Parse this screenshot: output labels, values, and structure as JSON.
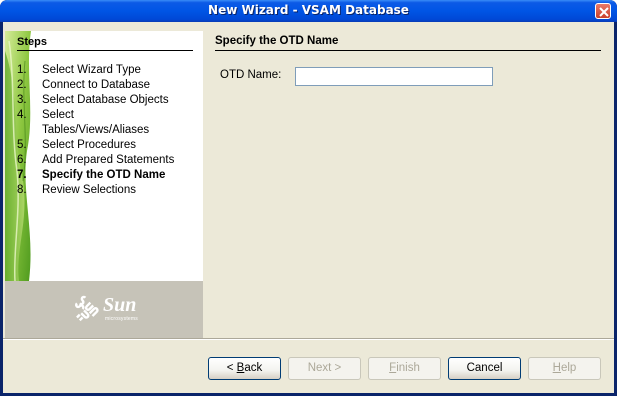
{
  "window": {
    "title": "New Wizard - VSAM Database"
  },
  "steps_panel": {
    "heading": "Steps",
    "items": [
      {
        "num": "1.",
        "label": "Select Wizard Type"
      },
      {
        "num": "2.",
        "label": "Connect to Database"
      },
      {
        "num": "3.",
        "label": "Select Database Objects"
      },
      {
        "num": "4.",
        "label": "Select Tables/Views/Aliases"
      },
      {
        "num": "5.",
        "label": "Select Procedures"
      },
      {
        "num": "6.",
        "label": "Add Prepared Statements"
      },
      {
        "num": "7.",
        "label": "Specify the OTD Name"
      },
      {
        "num": "8.",
        "label": "Review Selections"
      }
    ],
    "current_step": 7,
    "logo": {
      "word": "Sun",
      "sub": "microsystems"
    }
  },
  "content": {
    "heading": "Specify the OTD Name",
    "otd_label": "OTD Name:",
    "otd_value": ""
  },
  "buttons": {
    "back": {
      "prefix": "< ",
      "mnemonic": "B",
      "rest": "ack",
      "enabled": true
    },
    "next": {
      "label": "Next >",
      "enabled": false
    },
    "finish": {
      "mnemonic": "F",
      "rest": "inish",
      "enabled": false
    },
    "cancel": {
      "label": "Cancel",
      "enabled": true
    },
    "help": {
      "mnemonic": "H",
      "rest": "elp",
      "enabled": false
    }
  },
  "colors": {
    "title_bar": "#0055e5",
    "dialog_bg": "#ece9d8",
    "logo_area": "#c6c3b8",
    "leaf_green": "#7cbf2a"
  }
}
